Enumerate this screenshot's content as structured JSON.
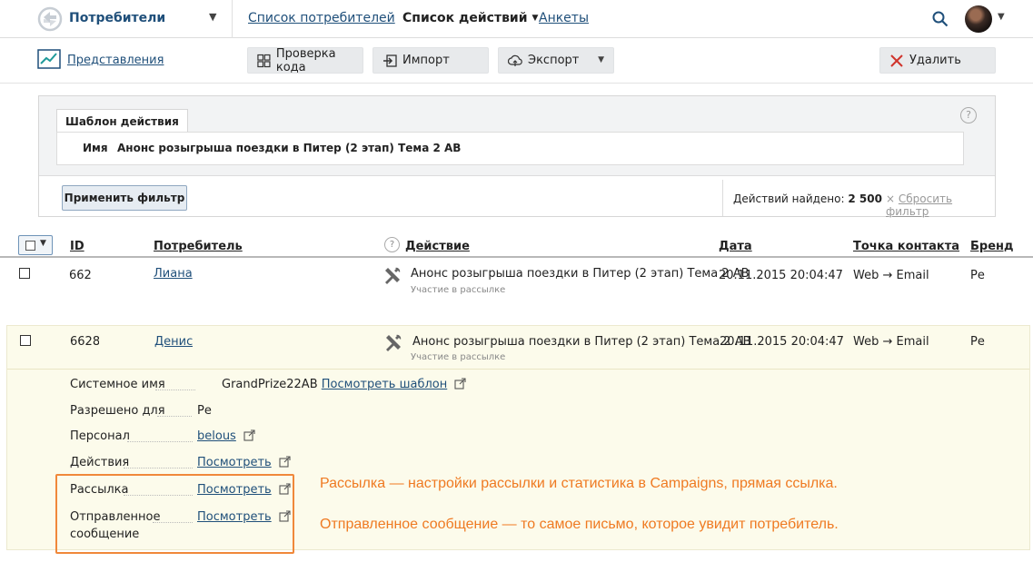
{
  "topbar": {
    "app_title": "Потребители",
    "nav": [
      {
        "label": "Список потребителей"
      },
      {
        "label": "Список действий"
      },
      {
        "label": "Анкеты"
      }
    ]
  },
  "toolbar": {
    "views_label": "Представления",
    "check_code": "Проверка кода",
    "import": "Импорт",
    "export": "Экспорт",
    "delete": "Удалить"
  },
  "filter": {
    "tab": "Шаблон действия",
    "name_label": "Имя",
    "name_value": "Анонс розыгрыша поездки в Питер (2 этап) Тема 2 АВ",
    "help": "?",
    "apply": "Применить фильтр",
    "found_label": "Действий найдено:",
    "found_count": "2 500",
    "reset": "Сбросить фильтр"
  },
  "table": {
    "headers": {
      "id": "ID",
      "consumer": "Потребитель",
      "action": "Действие",
      "date": "Дата",
      "contact": "Точка контакта",
      "brand": "Бренд"
    },
    "rows": [
      {
        "id": "662",
        "consumer": "Лиана",
        "action": "Анонс розыгрыша поездки в Питер (2 этап) Тема 2 АВ",
        "action_sub": "Участие в рассылке",
        "date": "20.11.2015 20:04:47",
        "contact": "Web → Email",
        "brand": "Ре"
      },
      {
        "id": "6628",
        "consumer": "Денис",
        "action": "Анонс розыгрыша поездки в Питер (2 этап) Тема 2 АВ",
        "action_sub": "Участие в рассылке",
        "date": "20.11.2015 20:04:47",
        "contact": "Web → Email",
        "brand": "Ре"
      }
    ],
    "details": {
      "system_name_label": "Системное имя",
      "system_name_value": "GrandPrize22AB",
      "view_template": "Посмотреть шаблон",
      "allowed_label": "Разрешено для",
      "allowed_value": "Ре",
      "staff_label": "Персонал",
      "staff_value": "belous",
      "actions_label": "Действия",
      "actions_value": "Посмотреть",
      "mailing_label": "Рассылка",
      "mailing_value": "Посмотреть",
      "sent_label_1": "Отправленное",
      "sent_label_2": "сообщение",
      "sent_value": "Посмотреть"
    }
  },
  "annotations": {
    "line1": "Рассылка — настройки рассылки и статистика в Campaigns, прямая ссылка.",
    "line2": "Отправленное сообщение — то самое письмо, которое увидит потребитель."
  },
  "colors": {
    "accent": "#1f4f7a",
    "highlight": "#ef7a22",
    "expanded_row": "#fcfbeb"
  }
}
